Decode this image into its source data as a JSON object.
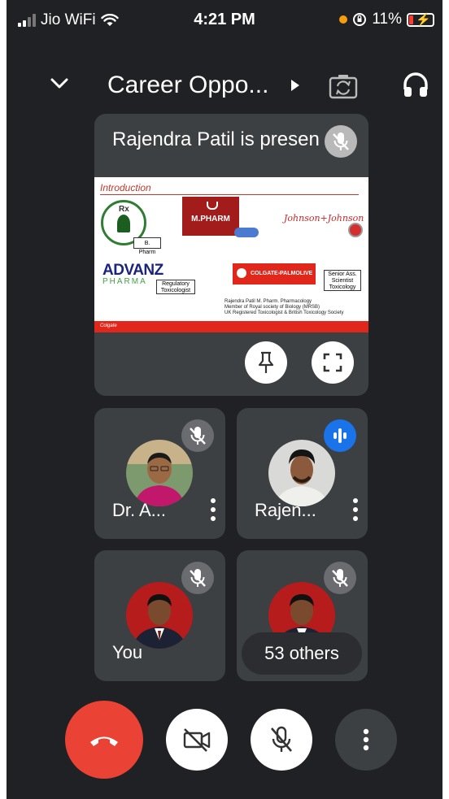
{
  "status_bar": {
    "carrier": "Jio WiFi",
    "time": "4:21 PM",
    "battery": "11%"
  },
  "header": {
    "title": "Career Oppo..."
  },
  "presentation": {
    "presenter_text": "Rajendra Patil is presen",
    "slide": {
      "heading": "Introduction",
      "bpharm_label": "B. Pharm",
      "mpharm_label": "M.PHARM",
      "jj_label": "Johnson+Johnson",
      "advanz_label": "ADVANZ",
      "advanz_sub": "PHARMA",
      "reg_tox_label": "Regulatory Toxicologist",
      "colgate_label": "COLGATE-PALMOLIVE",
      "senior_label": "Senior Ass. Scientist Toxicology",
      "credits_line1": "Rajendra Patil M. Pharm. Pharmacology",
      "credits_line2": "Member of Royal society of Biology (MRSB)",
      "credits_line3": "UK Registered Toxicologist & British Toxicology Society",
      "footer_logo": "Colgate"
    }
  },
  "participants": [
    {
      "name": "Dr. A...",
      "muted": true
    },
    {
      "name": "Rajen...",
      "speaking": true
    },
    {
      "name": "You",
      "muted": true
    },
    {
      "name": "53 others",
      "muted": true
    }
  ],
  "colors": {
    "background": "#202124",
    "tile": "#3c4043",
    "end_call": "#ea4335",
    "speaking_badge": "#1a73e8"
  }
}
